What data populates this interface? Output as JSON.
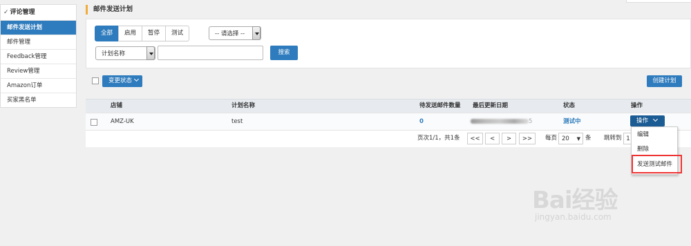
{
  "sidebar": {
    "header": "评论管理",
    "items": [
      {
        "label": "邮件发送计划",
        "active": true
      },
      {
        "label": "邮件管理",
        "active": false
      },
      {
        "label": "Feedback管理",
        "active": false
      },
      {
        "label": "Review管理",
        "active": false
      },
      {
        "label": "Amazon订单",
        "active": false
      },
      {
        "label": "买家黑名单",
        "active": false
      }
    ]
  },
  "page": {
    "title": "邮件发送计划"
  },
  "filters": {
    "tabs": [
      "全部",
      "启用",
      "暂停",
      "测试"
    ],
    "active_tab": "全部",
    "status_select": "-- 请选择 --",
    "field_select": "计划名称",
    "search_value": "",
    "search_button": "搜索"
  },
  "toolbar": {
    "change_status": "变更状态",
    "create_plan": "创建计划"
  },
  "table": {
    "headers": [
      "店铺",
      "计划名称",
      "待发送邮件数量",
      "最后更新日期",
      "状态",
      "操作"
    ],
    "rows": [
      {
        "store": "AMZ-UK",
        "plan_name": "test",
        "pending": "0",
        "updated_suffix": "5",
        "status": "测试中",
        "action": "操作"
      }
    ]
  },
  "pagination": {
    "info": "页次1/1，共1条",
    "first": "<<",
    "prev": "<",
    "next": ">",
    "last": ">>",
    "per_page_label": "每页",
    "per_page": "20",
    "unit": "条",
    "goto_label": "跳转到",
    "goto_value": "1"
  },
  "action_menu": {
    "items": [
      "编辑",
      "删除",
      "发送测试邮件"
    ],
    "highlighted": "发送测试邮件"
  },
  "watermark": {
    "main": "Bai经验",
    "sub": "jingyan.baidu.com"
  },
  "colors": {
    "accent": "#2e7bbd",
    "title_bar": "#f0ad3c",
    "highlight": "#ee3333"
  }
}
